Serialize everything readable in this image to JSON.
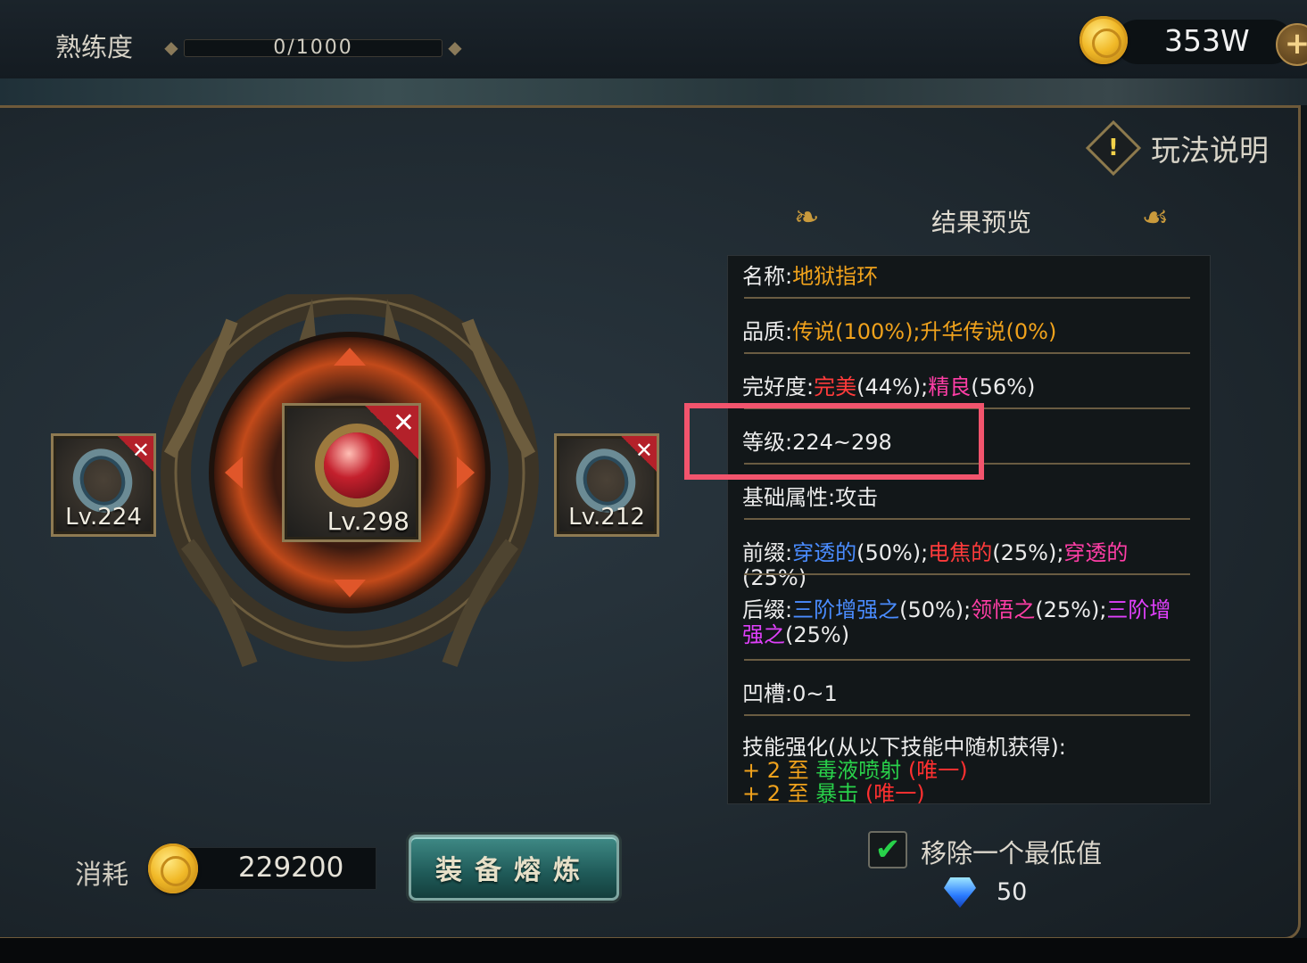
{
  "header": {
    "proficiency_label": "熟练度",
    "proficiency_value": "0/1000",
    "gold_amount": "353W",
    "add_gold": "+"
  },
  "help": {
    "label": "玩法说明",
    "icon": "!"
  },
  "result": {
    "title": "结果预览",
    "wing_left": "❧",
    "wing_right": "☙"
  },
  "items": {
    "left": {
      "level": "Lv.224",
      "remove": "✕"
    },
    "center": {
      "level": "Lv.298",
      "remove": "✕"
    },
    "right": {
      "level": "Lv.212",
      "remove": "✕"
    }
  },
  "preview": {
    "name_label": "名称:",
    "name_value": "地狱指环",
    "quality_label": "品质:",
    "quality_value": "传说(100%);升华传说(0%)",
    "integrity_label": "完好度:",
    "integrity_perfect": "完美",
    "integrity_perfect_pct": "(44%);",
    "integrity_good": "精良",
    "integrity_good_pct": "(56%)",
    "level_label": "等级:",
    "level_value": "224~298",
    "base_attr_label": "基础属性:",
    "base_attr_value": "攻击",
    "prefix_label": "前缀:",
    "prefix_1": "穿透的",
    "prefix_1_pct": "(50%);",
    "prefix_2": "电焦的",
    "prefix_2_pct": "(25%);",
    "prefix_3": "穿透的",
    "prefix_3_pct": "(25%)",
    "suffix_label": "后缀:",
    "suffix_1": "三阶增强之",
    "suffix_1_pct": "(50%);",
    "suffix_2": "领悟之",
    "suffix_2_pct": "(25%);",
    "suffix_3a": "三阶增",
    "suffix_3b": "强之",
    "suffix_3_pct": "(25%)",
    "socket_label": "凹槽:",
    "socket_value": "0~1",
    "skill_label": "技能强化(从以下技能中随机获得):",
    "skill_1_prefix": "+ 2 至 ",
    "skill_1_name": "毒液喷射",
    "skill_1_tag": " (唯一)",
    "skill_2_prefix": "+ 2 至 ",
    "skill_2_name": "暴击",
    "skill_2_tag": " (唯一)"
  },
  "footer": {
    "cost_label": "消耗",
    "cost_value": "229200",
    "smelt_button": "装备熔炼",
    "remove_lowest_check": "✔",
    "remove_lowest_label": "移除一个最低值",
    "diamond_cost": "50"
  },
  "colors": {
    "legendary": "#f0a21c",
    "perfect": "#ff3b3b",
    "fine": "#ff3ea6",
    "blue_affix": "#4a8cff",
    "magenta_affix": "#e040fb",
    "skill_green": "#29d14a",
    "highlight_box": "#f2546d"
  }
}
